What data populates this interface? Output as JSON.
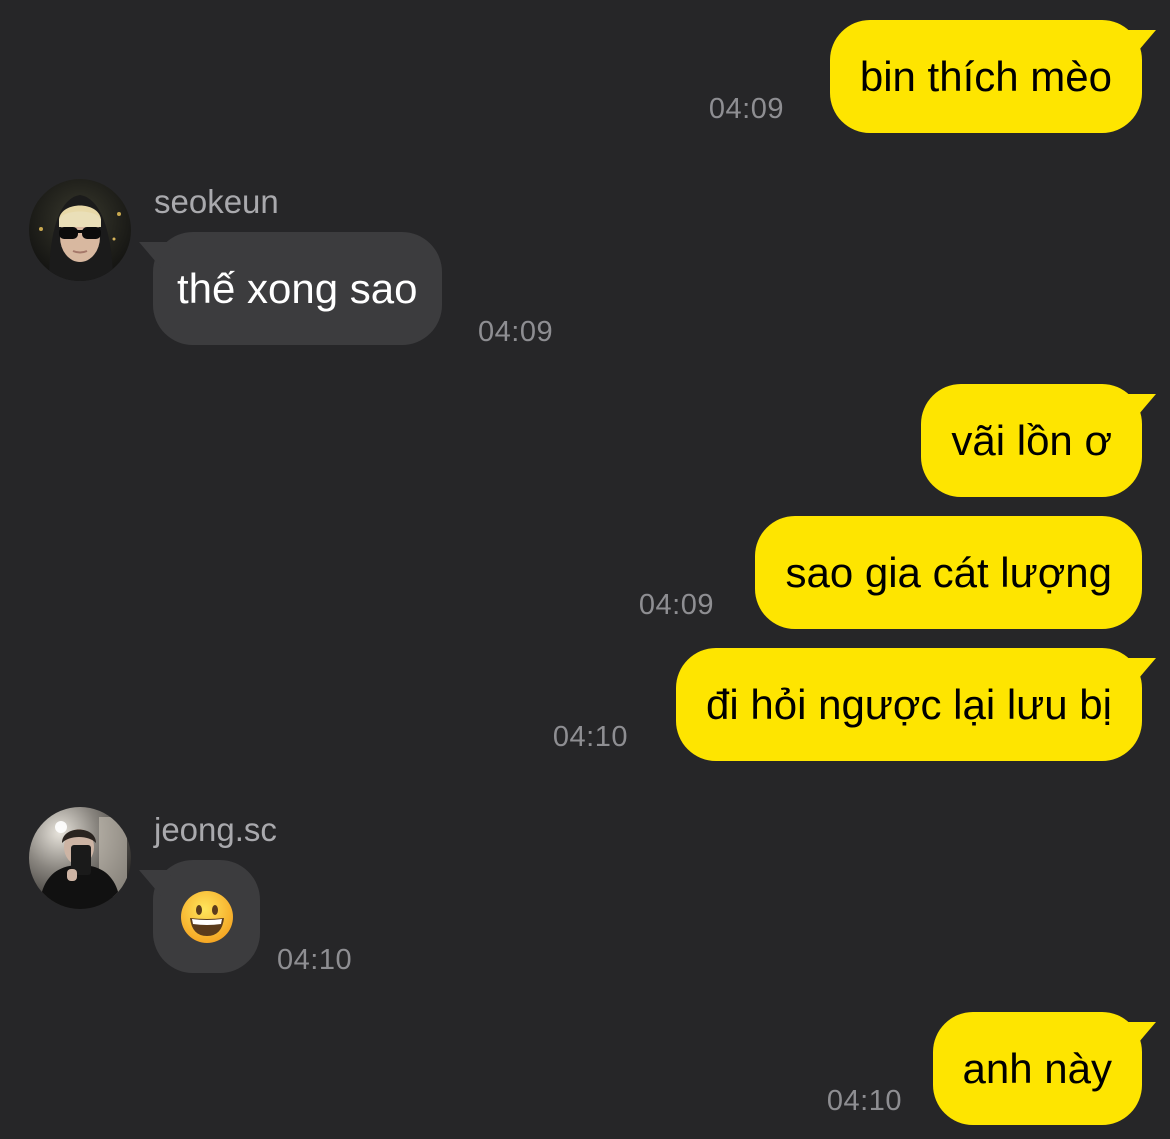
{
  "colors": {
    "background": "#262628",
    "outgoing_bubble": "#FEE500",
    "incoming_bubble": "#3C3C3E",
    "timestamp": "#8E8E92"
  },
  "messages": [
    {
      "direction": "outgoing",
      "text": "bin thích mèo",
      "time": "04:09"
    },
    {
      "direction": "incoming",
      "sender": "seokeun",
      "avatar_icon": "user-photo-sunglasses",
      "text": "thế xong sao",
      "time": "04:09"
    },
    {
      "direction": "outgoing",
      "text": "vãi lồn ơ",
      "time": ""
    },
    {
      "direction": "outgoing",
      "text": "sao gia cát lượng",
      "time": "04:09"
    },
    {
      "direction": "outgoing",
      "text": "đi hỏi ngược lại lưu bị",
      "time": "04:10"
    },
    {
      "direction": "incoming",
      "sender": "jeong.sc",
      "avatar_icon": "user-photo-mirror-selfie",
      "emoji_icon": "grinning-face-emoji",
      "text": "😀",
      "time": "04:10"
    },
    {
      "direction": "outgoing",
      "text": "anh này",
      "time": "04:10"
    }
  ]
}
